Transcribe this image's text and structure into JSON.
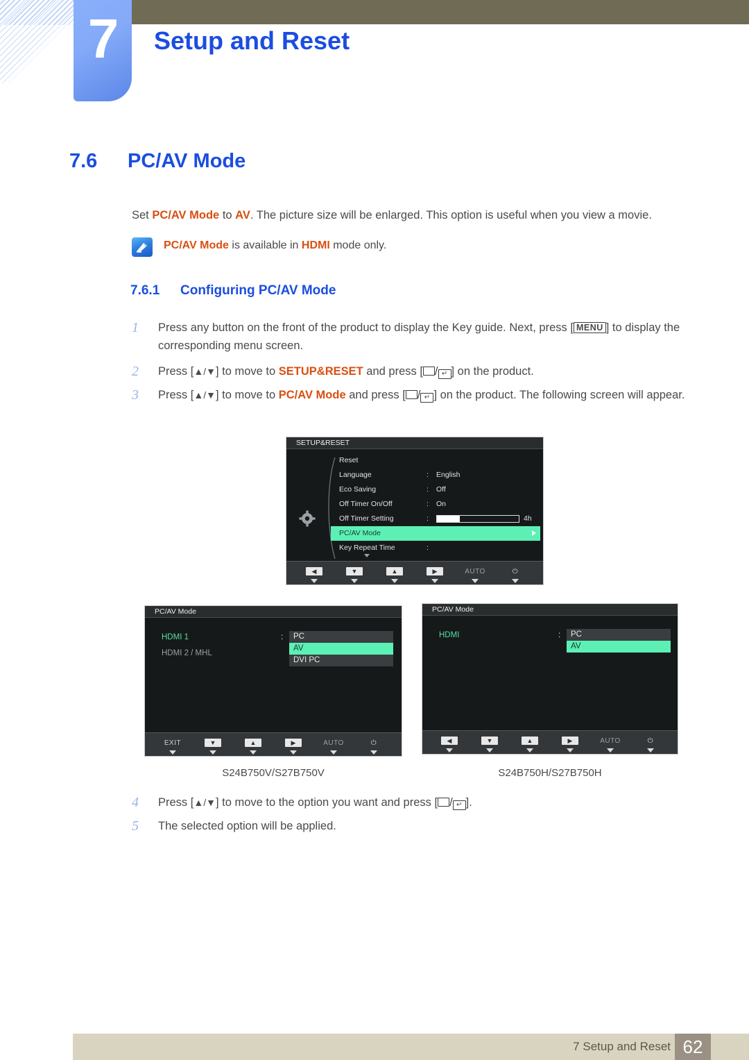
{
  "header": {
    "chapter_number": "7",
    "chapter_title": "Setup and Reset"
  },
  "headings": {
    "section_number": "7.6",
    "section_title": "PC/AV Mode",
    "sub_number": "7.6.1",
    "sub_title": "Configuring PC/AV Mode"
  },
  "intro": {
    "part1": "Set ",
    "bold1": "PC/AV Mode",
    "part2": " to ",
    "bold2": "AV",
    "part3": ". The picture size will be enlarged. This option is useful when you view a movie."
  },
  "note": {
    "icon": "note-pen-icon",
    "bold1": "PC/AV Mode",
    "part1": " is available in ",
    "bold2": "HDMI",
    "part2": " mode only."
  },
  "steps": {
    "s1": {
      "num": "1",
      "a": "Press any button on the front of the product to display the Key guide. Next, press [",
      "key": "MENU",
      "b": "] to display the corresponding menu screen."
    },
    "s2": {
      "num": "2",
      "a": "Press [",
      "arrows": "▲/▼",
      "b": "] to move to ",
      "bold": "SETUP&RESET",
      "c": " and press [",
      "d": "] on the product."
    },
    "s3": {
      "num": "3",
      "a": "Press [",
      "arrows": "▲/▼",
      "b": "] to move to ",
      "bold": "PC/AV Mode",
      "c": " and press [",
      "d": "] on the product. The following screen will appear."
    },
    "s4": {
      "num": "4",
      "a": "Press [",
      "arrows": "▲/▼",
      "b": "] to move to the option you want and press [",
      "c": "]."
    },
    "s5": {
      "num": "5",
      "a": "The selected option will be applied."
    }
  },
  "osd1": {
    "title": "SETUP&RESET",
    "icon": "gear-icon",
    "rows": [
      {
        "label": "Reset",
        "colon": "",
        "value": ""
      },
      {
        "label": "Language",
        "colon": ":",
        "value": "English"
      },
      {
        "label": "Eco Saving",
        "colon": ":",
        "value": "Off"
      },
      {
        "label": "Off Timer On/Off",
        "colon": ":",
        "value": "On"
      },
      {
        "label": "Off Timer Setting",
        "colon": ":",
        "value": "",
        "slider": 28,
        "slider_label": "4h"
      },
      {
        "label": "PC/AV Mode",
        "colon": "",
        "value": "",
        "selected": true
      },
      {
        "label": "Key Repeat Time",
        "colon": ":",
        "value": ""
      }
    ],
    "buttons": [
      {
        "type": "icon",
        "glyph": "◀",
        "name": "left-arrow"
      },
      {
        "type": "icon",
        "glyph": "▼",
        "name": "down-arrow"
      },
      {
        "type": "icon",
        "glyph": "▲",
        "name": "up-arrow"
      },
      {
        "type": "icon",
        "glyph": "▶",
        "name": "right-arrow"
      },
      {
        "type": "text",
        "glyph": "AUTO",
        "name": "auto"
      },
      {
        "type": "text",
        "glyph": "⏻",
        "name": "power"
      }
    ]
  },
  "osd2": {
    "title": "PC/AV Mode",
    "sources": [
      {
        "label": "HDMI 1",
        "active": true
      },
      {
        "label": "HDMI 2 / MHL",
        "active": false
      }
    ],
    "colon": ":",
    "options": [
      {
        "label": "PC",
        "selected": false
      },
      {
        "label": "AV",
        "selected": true
      },
      {
        "label": "DVI PC",
        "selected": false
      }
    ],
    "buttons": [
      {
        "type": "text",
        "glyph": "EXIT",
        "name": "exit"
      },
      {
        "type": "icon",
        "glyph": "▼",
        "name": "down-arrow"
      },
      {
        "type": "icon",
        "glyph": "▲",
        "name": "up-arrow"
      },
      {
        "type": "icon",
        "glyph": "▶",
        "name": "right-arrow"
      },
      {
        "type": "text",
        "glyph": "AUTO",
        "name": "auto"
      },
      {
        "type": "text",
        "glyph": "⏻",
        "name": "power"
      }
    ]
  },
  "osd3": {
    "title": "PC/AV Mode",
    "sources": [
      {
        "label": "HDMI",
        "active": true
      }
    ],
    "colon": ":",
    "options": [
      {
        "label": "PC",
        "selected": false
      },
      {
        "label": "AV",
        "selected": true
      }
    ],
    "buttons": [
      {
        "type": "icon",
        "glyph": "◀",
        "name": "back-arrow"
      },
      {
        "type": "icon",
        "glyph": "▼",
        "name": "down-arrow"
      },
      {
        "type": "icon",
        "glyph": "▲",
        "name": "up-arrow"
      },
      {
        "type": "icon",
        "glyph": "▶",
        "name": "right-arrow"
      },
      {
        "type": "text",
        "glyph": "AUTO",
        "name": "auto"
      },
      {
        "type": "text",
        "glyph": "⏻",
        "name": "power"
      }
    ]
  },
  "captions": {
    "left": "S24B750V/S27B750V",
    "right": "S24B750H/S27B750H"
  },
  "footer": {
    "text": "7 Setup and Reset",
    "page": "62"
  },
  "colors": {
    "accent_blue": "#1b4de0",
    "olive": "#6f6b55",
    "orange": "#d94f11",
    "osd_highlight": "#5cf0b5",
    "footer_bar": "#d8d4c0",
    "footer_page": "#9a9184"
  }
}
